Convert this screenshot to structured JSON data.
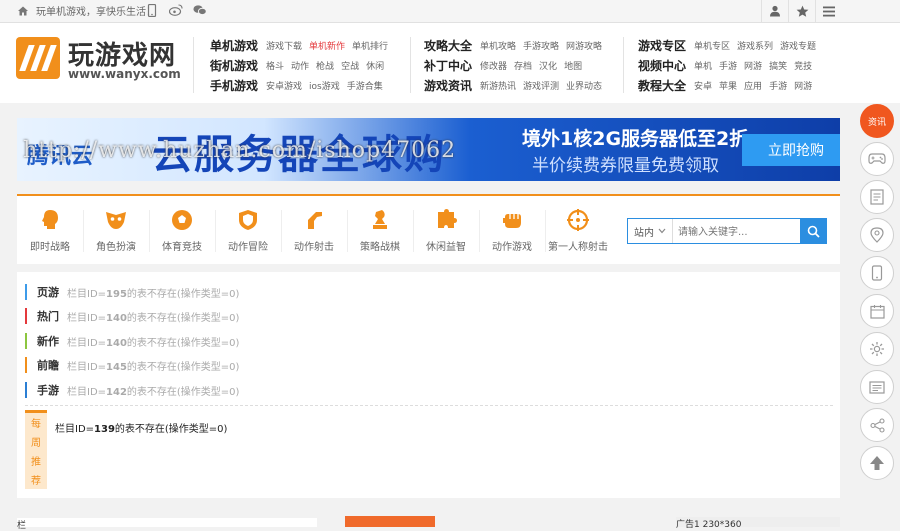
{
  "topbar": {
    "tagline": "玩单机游戏，享快乐生活！",
    "icons": [
      "home-icon",
      "mobile-icon",
      "weibo-icon",
      "wechat-icon"
    ],
    "right_icons": [
      "user-icon",
      "star-icon",
      "menu-icon"
    ]
  },
  "logo": {
    "title": "玩游戏网",
    "url": "www.wanyx.com"
  },
  "nav": [
    {
      "main": "单机游戏",
      "subs": [
        "游戏下载",
        "单机新作",
        "单机排行"
      ],
      "hot": 1
    },
    {
      "main": "街机游戏",
      "subs": [
        "格斗",
        "动作",
        "枪战",
        "空战",
        "休闲"
      ]
    },
    {
      "main": "手机游戏",
      "subs": [
        "安卓游戏",
        "ios游戏",
        "手游合集"
      ]
    },
    {
      "main": "攻略大全",
      "subs": [
        "单机攻略",
        "手游攻略",
        "网游攻略"
      ]
    },
    {
      "main": "补丁中心",
      "subs": [
        "修改器",
        "存档",
        "汉化",
        "地图"
      ]
    },
    {
      "main": "游戏资讯",
      "subs": [
        "新游热讯",
        "游戏评测",
        "业界动态"
      ]
    },
    {
      "main": "游戏专区",
      "subs": [
        "单机专区",
        "游戏系列",
        "游戏专题"
      ]
    },
    {
      "main": "视频中心",
      "subs": [
        "单机",
        "手游",
        "网游",
        "搞笑",
        "竞技"
      ]
    },
    {
      "main": "教程大全",
      "subs": [
        "安卓",
        "苹果",
        "应用",
        "手游",
        "网游"
      ]
    }
  ],
  "banner": {
    "brand": "腾讯云",
    "headline": "云服务器全球购",
    "line1": "境外1核2G服务器低至2折",
    "line2": "半价续费券限量免费领取",
    "button": "立即抢购",
    "watermark": "http://www.huzhan.com/ishop47062"
  },
  "categories": [
    {
      "label": "即时战略",
      "icon": "head-icon"
    },
    {
      "label": "角色扮演",
      "icon": "mask-icon"
    },
    {
      "label": "体育竞技",
      "icon": "ball-icon"
    },
    {
      "label": "动作冒险",
      "icon": "shield-icon"
    },
    {
      "label": "动作射击",
      "icon": "gun-icon"
    },
    {
      "label": "策略战棋",
      "icon": "chess-icon"
    },
    {
      "label": "休闲益智",
      "icon": "puzzle-icon"
    },
    {
      "label": "动作游戏",
      "icon": "fist-icon"
    },
    {
      "label": "第一人称射击",
      "icon": "crosshair-icon"
    }
  ],
  "search": {
    "select": "站内",
    "placeholder": "请输入关键字..."
  },
  "list_rows": [
    {
      "label": "页游",
      "prefix": "栏目ID=",
      "id": "195",
      "suffix": "的表不存在(操作类型=0)",
      "color": "#3d9be9"
    },
    {
      "label": "热门",
      "prefix": "栏目ID=",
      "id": "140",
      "suffix": "的表不存在(操作类型=0)",
      "color": "#e4393c"
    },
    {
      "label": "新作",
      "prefix": "栏目ID=",
      "id": "140",
      "suffix": "的表不存在(操作类型=0)",
      "color": "#8cc63f"
    },
    {
      "label": "前瞻",
      "prefix": "栏目ID=",
      "id": "145",
      "suffix": "的表不存在(操作类型=0)",
      "color": "#f18f1b"
    },
    {
      "label": "手游",
      "prefix": "栏目ID=",
      "id": "142",
      "suffix": "的表不存在(操作类型=0)",
      "color": "#2b7fd4"
    }
  ],
  "ribbon": {
    "chars": [
      "每",
      "周",
      "推",
      "荐"
    ]
  },
  "ribbon_msg": {
    "prefix": "栏目ID=",
    "id": "139",
    "suffix": "的表不存在(操作类型=0)"
  },
  "bottom": {
    "b1": "栏",
    "b3": "广告1 230*360"
  },
  "rail": {
    "hot_label": "资讯",
    "icons": [
      "gamepad-icon",
      "document-icon",
      "location-icon",
      "phone-icon",
      "calendar-icon",
      "settings-icon",
      "list-icon",
      "share-icon",
      "arrow-up-icon"
    ]
  },
  "colors": {
    "accent": "#f18f1b",
    "blue": "#2b8ee0",
    "hot": "#f0571f"
  }
}
